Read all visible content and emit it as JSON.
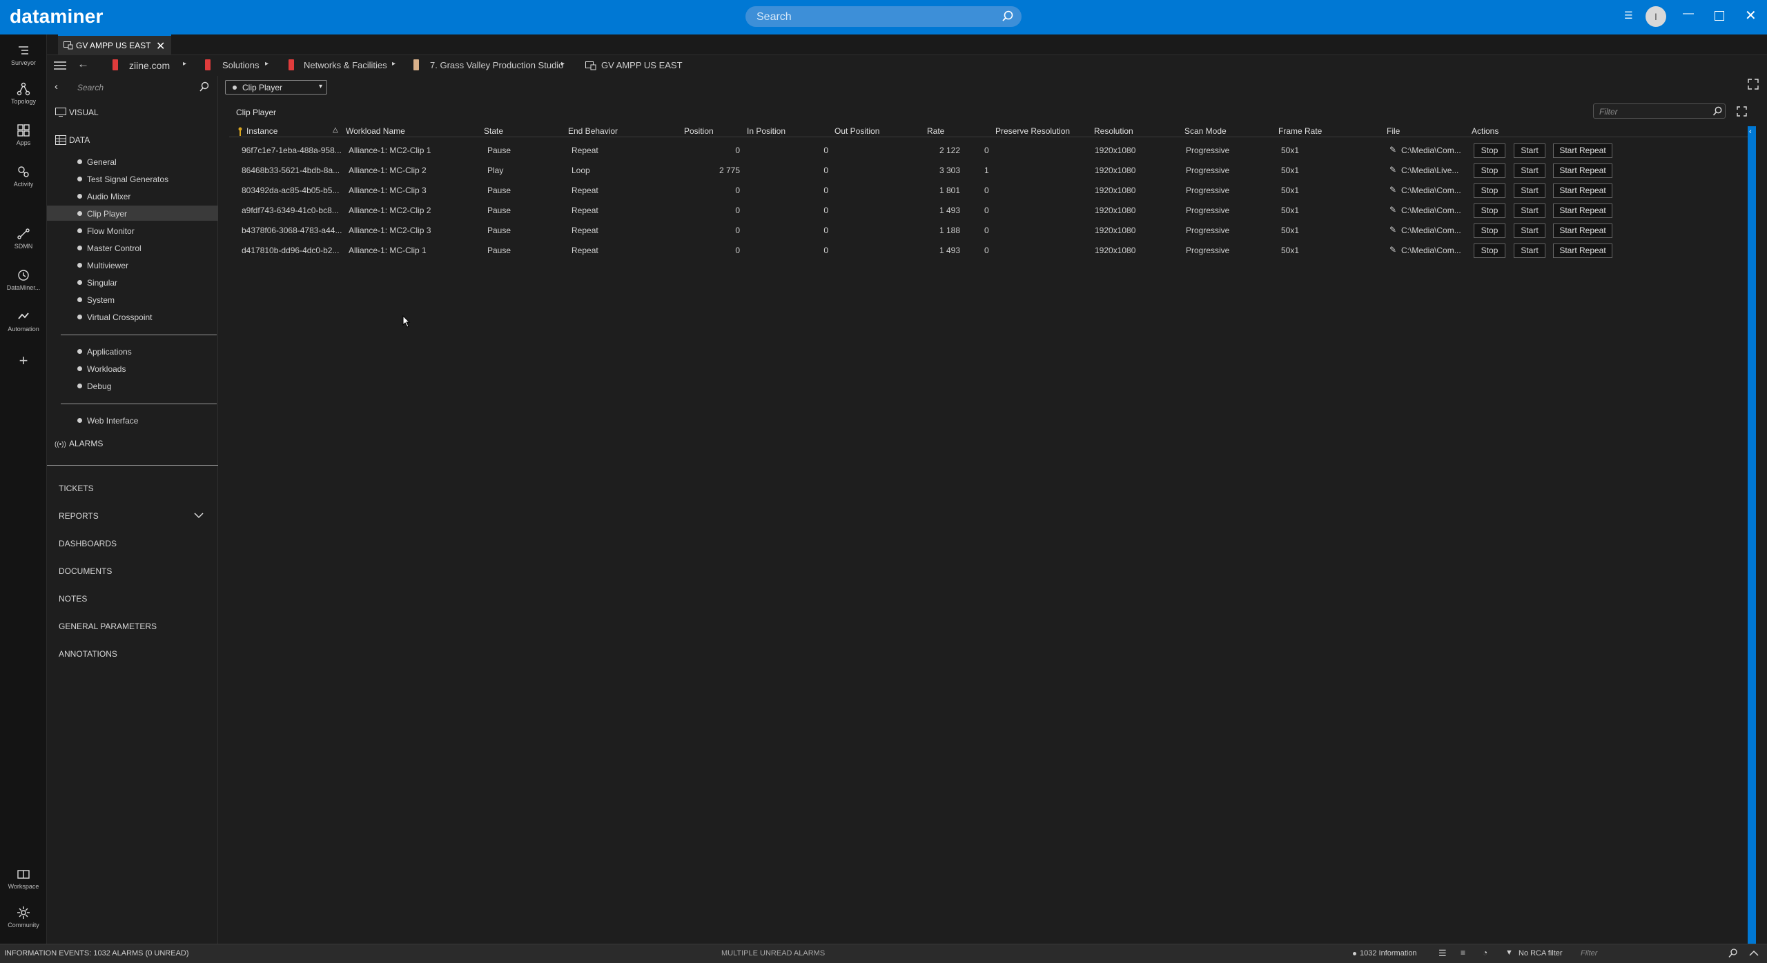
{
  "app": {
    "logo": "dataminer",
    "search_placeholder": "Search",
    "user_initial": "I"
  },
  "rail": [
    {
      "label": "Surveyor"
    },
    {
      "label": "Topology"
    },
    {
      "label": "Apps"
    },
    {
      "label": "Activity"
    },
    {
      "label": "SDMN"
    },
    {
      "label": "DataMiner..."
    },
    {
      "label": "Automation"
    },
    {
      "label": "Workspace"
    },
    {
      "label": "Community"
    }
  ],
  "tab": {
    "label": "GV AMPP US EAST"
  },
  "breadcrumb": [
    "ziine.com",
    "Solutions",
    "Networks & Facilities",
    "7. Grass Valley Production Studio",
    "GV AMPP US EAST"
  ],
  "sidenav": {
    "search_placeholder": "Search",
    "visual": "VISUAL",
    "data": "DATA",
    "data_items": [
      "General",
      "Test Signal Generatos",
      "Audio Mixer",
      "Clip Player",
      "Flow Monitor",
      "Master Control",
      "Multiviewer",
      "Singular",
      "System",
      "Virtual Crosspoint"
    ],
    "extra_items": [
      "Applications",
      "Workloads",
      "Debug"
    ],
    "web_item": "Web Interface",
    "alarms": "ALARMS",
    "lower": [
      "TICKETS",
      "REPORTS",
      "DASHBOARDS",
      "DOCUMENTS",
      "NOTES",
      "GENERAL PARAMETERS",
      "ANNOTATIONS"
    ]
  },
  "main": {
    "combo_value": "Clip Player",
    "title": "Clip Player",
    "filter_placeholder": "Filter",
    "columns": [
      "Instance",
      "Workload Name",
      "State",
      "End Behavior",
      "Position",
      "In Position",
      "Out Position",
      "Rate",
      "Preserve Resolution",
      "Resolution",
      "Scan Mode",
      "Frame Rate",
      "File",
      "Actions"
    ],
    "rows": [
      {
        "instance": "96f7c1e7-1eba-488a-958...",
        "workload": "Alliance-1: MC2-Clip 1",
        "state": "Pause",
        "end": "Repeat",
        "position": "0",
        "in": "0",
        "out": "2 122",
        "rate": "0",
        "res": "1920x1080",
        "scan": "Progressive",
        "fps": "50x1",
        "file": "C:\\Media\\Com..."
      },
      {
        "instance": "86468b33-5621-4bdb-8a...",
        "workload": "Alliance-1: MC-Clip 2",
        "state": "Play",
        "end": "Loop",
        "position": "2 775",
        "in": "0",
        "out": "3 303",
        "rate": "1",
        "res": "1920x1080",
        "scan": "Progressive",
        "fps": "50x1",
        "file": "C:\\Media\\Live..."
      },
      {
        "instance": "803492da-ac85-4b05-b5...",
        "workload": "Alliance-1: MC-Clip 3",
        "state": "Pause",
        "end": "Repeat",
        "position": "0",
        "in": "0",
        "out": "1 801",
        "rate": "0",
        "res": "1920x1080",
        "scan": "Progressive",
        "fps": "50x1",
        "file": "C:\\Media\\Com..."
      },
      {
        "instance": "a9fdf743-6349-41c0-bc8...",
        "workload": "Alliance-1: MC2-Clip 2",
        "state": "Pause",
        "end": "Repeat",
        "position": "0",
        "in": "0",
        "out": "1 493",
        "rate": "0",
        "res": "1920x1080",
        "scan": "Progressive",
        "fps": "50x1",
        "file": "C:\\Media\\Com..."
      },
      {
        "instance": "b4378f06-3068-4783-a44...",
        "workload": "Alliance-1: MC2-Clip 3",
        "state": "Pause",
        "end": "Repeat",
        "position": "0",
        "in": "0",
        "out": "1 188",
        "rate": "0",
        "res": "1920x1080",
        "scan": "Progressive",
        "fps": "50x1",
        "file": "C:\\Media\\Com..."
      },
      {
        "instance": "d417810b-dd96-4dc0-b2...",
        "workload": "Alliance-1: MC-Clip 1",
        "state": "Pause",
        "end": "Repeat",
        "position": "0",
        "in": "0",
        "out": "1 493",
        "rate": "0",
        "res": "1920x1080",
        "scan": "Progressive",
        "fps": "50x1",
        "file": "C:\\Media\\Com..."
      }
    ],
    "actions": [
      "Stop",
      "Start",
      "Start Repeat"
    ]
  },
  "status": {
    "left": "INFORMATION EVENTS: 1032 ALARMS (0 UNREAD)",
    "center": "MULTIPLE UNREAD ALARMS",
    "info_count": "1032 Information",
    "rca": "No RCA filter",
    "filter_placeholder": "Filter"
  },
  "colors": {
    "accent": "#0078d4",
    "crumb_icon": "#e03c3c"
  }
}
